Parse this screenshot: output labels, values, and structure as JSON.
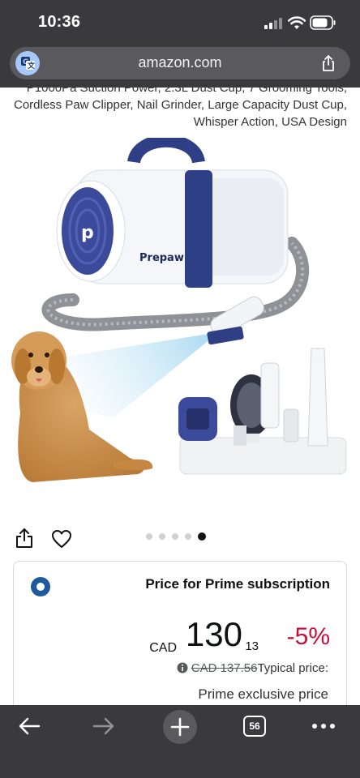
{
  "status_bar": {
    "time": "10:36"
  },
  "browser": {
    "url": "amazon.com",
    "tab_count": "56"
  },
  "product": {
    "title_partial": "P1000Pa Suction Power, 2.3L Dust Cup, 7 Grooming Tools, Cordless Paw Clipper, Nail Grinder, Large Capacity Dust Cup, Whisper Action, USA Design",
    "brand_on_device": "Prepaw",
    "carousel": {
      "total": 5,
      "active_index": 4
    }
  },
  "price_card": {
    "heading": "Price for Prime subscription",
    "currency": "CAD",
    "whole": "130",
    "fraction": "13",
    "discount": "-5%",
    "old_price": "CAD 137.56",
    "typical_label": "Typical price:",
    "prime_exclusive": "Prime exclusive price"
  },
  "colors": {
    "chrome": "#3a3a3c",
    "discount_red": "#cc0c39",
    "radio_blue": "#1f5a9e",
    "device_blue": "#2f3f86"
  }
}
